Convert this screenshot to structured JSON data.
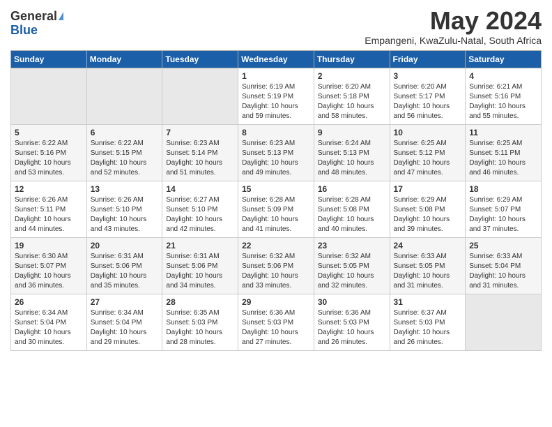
{
  "logo": {
    "general": "General",
    "blue": "Blue"
  },
  "title": "May 2024",
  "subtitle": "Empangeni, KwaZulu-Natal, South Africa",
  "days_of_week": [
    "Sunday",
    "Monday",
    "Tuesday",
    "Wednesday",
    "Thursday",
    "Friday",
    "Saturday"
  ],
  "weeks": [
    [
      {
        "day": "",
        "empty": true
      },
      {
        "day": "",
        "empty": true
      },
      {
        "day": "",
        "empty": true
      },
      {
        "day": "1",
        "sunrise": "6:19 AM",
        "sunset": "5:19 PM",
        "daylight": "10 hours and 59 minutes."
      },
      {
        "day": "2",
        "sunrise": "6:20 AM",
        "sunset": "5:18 PM",
        "daylight": "10 hours and 58 minutes."
      },
      {
        "day": "3",
        "sunrise": "6:20 AM",
        "sunset": "5:17 PM",
        "daylight": "10 hours and 56 minutes."
      },
      {
        "day": "4",
        "sunrise": "6:21 AM",
        "sunset": "5:16 PM",
        "daylight": "10 hours and 55 minutes."
      }
    ],
    [
      {
        "day": "5",
        "sunrise": "6:22 AM",
        "sunset": "5:16 PM",
        "daylight": "10 hours and 53 minutes."
      },
      {
        "day": "6",
        "sunrise": "6:22 AM",
        "sunset": "5:15 PM",
        "daylight": "10 hours and 52 minutes."
      },
      {
        "day": "7",
        "sunrise": "6:23 AM",
        "sunset": "5:14 PM",
        "daylight": "10 hours and 51 minutes."
      },
      {
        "day": "8",
        "sunrise": "6:23 AM",
        "sunset": "5:13 PM",
        "daylight": "10 hours and 49 minutes."
      },
      {
        "day": "9",
        "sunrise": "6:24 AM",
        "sunset": "5:13 PM",
        "daylight": "10 hours and 48 minutes."
      },
      {
        "day": "10",
        "sunrise": "6:25 AM",
        "sunset": "5:12 PM",
        "daylight": "10 hours and 47 minutes."
      },
      {
        "day": "11",
        "sunrise": "6:25 AM",
        "sunset": "5:11 PM",
        "daylight": "10 hours and 46 minutes."
      }
    ],
    [
      {
        "day": "12",
        "sunrise": "6:26 AM",
        "sunset": "5:11 PM",
        "daylight": "10 hours and 44 minutes."
      },
      {
        "day": "13",
        "sunrise": "6:26 AM",
        "sunset": "5:10 PM",
        "daylight": "10 hours and 43 minutes."
      },
      {
        "day": "14",
        "sunrise": "6:27 AM",
        "sunset": "5:10 PM",
        "daylight": "10 hours and 42 minutes."
      },
      {
        "day": "15",
        "sunrise": "6:28 AM",
        "sunset": "5:09 PM",
        "daylight": "10 hours and 41 minutes."
      },
      {
        "day": "16",
        "sunrise": "6:28 AM",
        "sunset": "5:08 PM",
        "daylight": "10 hours and 40 minutes."
      },
      {
        "day": "17",
        "sunrise": "6:29 AM",
        "sunset": "5:08 PM",
        "daylight": "10 hours and 39 minutes."
      },
      {
        "day": "18",
        "sunrise": "6:29 AM",
        "sunset": "5:07 PM",
        "daylight": "10 hours and 37 minutes."
      }
    ],
    [
      {
        "day": "19",
        "sunrise": "6:30 AM",
        "sunset": "5:07 PM",
        "daylight": "10 hours and 36 minutes."
      },
      {
        "day": "20",
        "sunrise": "6:31 AM",
        "sunset": "5:06 PM",
        "daylight": "10 hours and 35 minutes."
      },
      {
        "day": "21",
        "sunrise": "6:31 AM",
        "sunset": "5:06 PM",
        "daylight": "10 hours and 34 minutes."
      },
      {
        "day": "22",
        "sunrise": "6:32 AM",
        "sunset": "5:06 PM",
        "daylight": "10 hours and 33 minutes."
      },
      {
        "day": "23",
        "sunrise": "6:32 AM",
        "sunset": "5:05 PM",
        "daylight": "10 hours and 32 minutes."
      },
      {
        "day": "24",
        "sunrise": "6:33 AM",
        "sunset": "5:05 PM",
        "daylight": "10 hours and 31 minutes."
      },
      {
        "day": "25",
        "sunrise": "6:33 AM",
        "sunset": "5:04 PM",
        "daylight": "10 hours and 31 minutes."
      }
    ],
    [
      {
        "day": "26",
        "sunrise": "6:34 AM",
        "sunset": "5:04 PM",
        "daylight": "10 hours and 30 minutes."
      },
      {
        "day": "27",
        "sunrise": "6:34 AM",
        "sunset": "5:04 PM",
        "daylight": "10 hours and 29 minutes."
      },
      {
        "day": "28",
        "sunrise": "6:35 AM",
        "sunset": "5:03 PM",
        "daylight": "10 hours and 28 minutes."
      },
      {
        "day": "29",
        "sunrise": "6:36 AM",
        "sunset": "5:03 PM",
        "daylight": "10 hours and 27 minutes."
      },
      {
        "day": "30",
        "sunrise": "6:36 AM",
        "sunset": "5:03 PM",
        "daylight": "10 hours and 26 minutes."
      },
      {
        "day": "31",
        "sunrise": "6:37 AM",
        "sunset": "5:03 PM",
        "daylight": "10 hours and 26 minutes."
      },
      {
        "day": "",
        "empty": true
      }
    ]
  ],
  "labels": {
    "sunrise": "Sunrise:",
    "sunset": "Sunset:",
    "daylight": "Daylight:"
  }
}
